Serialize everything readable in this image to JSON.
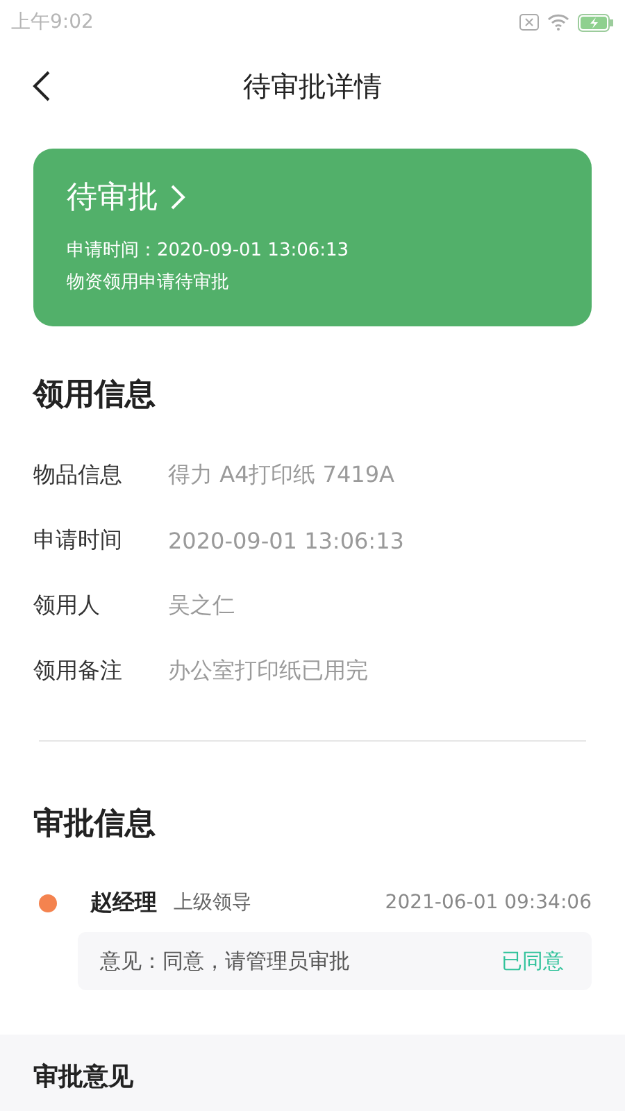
{
  "status_bar": {
    "time": "上午9:02"
  },
  "nav": {
    "title": "待审批详情"
  },
  "status_card": {
    "status": "待审批",
    "apply_time": "申请时间：2020-09-01 13:06:13",
    "description": "物资领用申请待审批"
  },
  "usage_info": {
    "title": "领用信息",
    "fields": [
      {
        "label": "物品信息",
        "value": "得力 A4打印纸 7419A"
      },
      {
        "label": "申请时间",
        "value": "2020-09-01 13:06:13"
      },
      {
        "label": "领用人",
        "value": "吴之仁"
      },
      {
        "label": "领用备注",
        "value": "办公室打印纸已用完"
      }
    ]
  },
  "approval_info": {
    "title": "审批信息",
    "records": [
      {
        "name": "赵经理",
        "role": "上级领导",
        "time": "2021-06-01 09:34:06",
        "color": "#f4834f",
        "comment": "意见：同意，请管理员审批",
        "result": "已同意"
      }
    ]
  },
  "opinion_section": {
    "title": "审批意见"
  }
}
